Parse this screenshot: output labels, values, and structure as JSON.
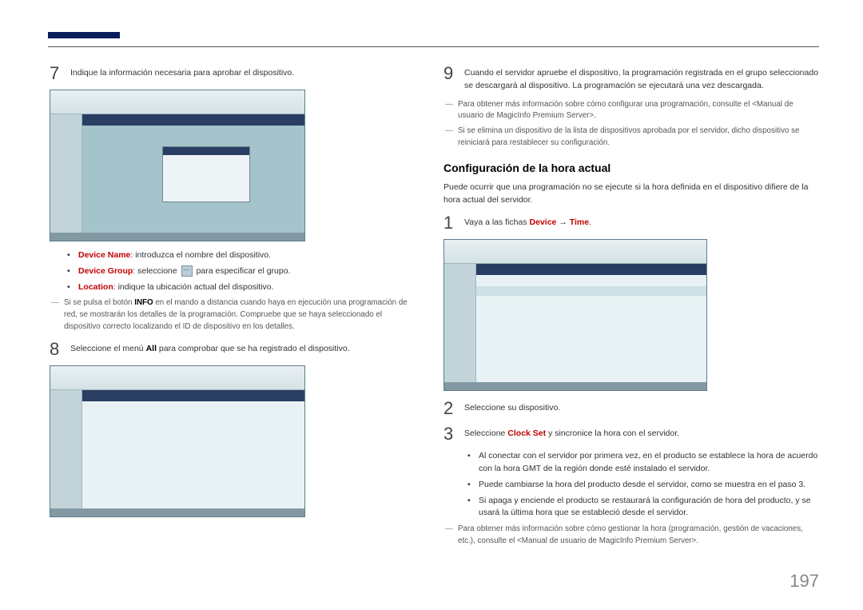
{
  "page_number": "197",
  "left": {
    "step7": {
      "num": "7",
      "text": "Indique la información necesaria para aprobar el dispositivo."
    },
    "bullets7": {
      "b1_label": "Device Name",
      "b1_rest": ": introduzca el nombre del dispositivo.",
      "b2_label": "Device Group",
      "b2_rest_a": ": seleccione ",
      "b2_rest_b": " para especificar el grupo.",
      "b3_label": "Location",
      "b3_rest": ": indique la ubicación actual del dispositivo."
    },
    "note7_a": "Si se pulsa el botón ",
    "note7_b": "INFO",
    "note7_c": " en el mando a distancia cuando haya en ejecución una programación de red, se mostrarán los detalles de la programación. Compruebe que se haya seleccionado el dispositivo correcto localizando el ID de dispositivo en los detalles.",
    "step8": {
      "num": "8",
      "text_a": "Seleccione el menú ",
      "text_b": "All",
      "text_c": " para comprobar que se ha registrado el dispositivo."
    }
  },
  "right": {
    "step9": {
      "num": "9",
      "text": "Cuando el servidor apruebe el dispositivo, la programación registrada en el grupo seleccionado se descargará al dispositivo. La programación se ejecutará una vez descargada."
    },
    "note9a": "Para obtener más información sobre cómo configurar una programación, consulte el <Manual de usuario de MagicInfo Premium Server>.",
    "note9b": "Si se elimina un dispositivo de la lista de dispositivos aprobada por el servidor, dicho dispositivo se reiniciará para restablecer su configuración.",
    "h_time": "Configuración de la hora actual",
    "time_intro": "Puede ocurrir que una programación no se ejecute si la hora definida en el dispositivo difiere de la hora actual del servidor.",
    "t1": {
      "num": "1",
      "a": "Vaya a las fichas ",
      "b": "Device",
      "c": " → ",
      "d": "Time",
      "e": "."
    },
    "t2": {
      "num": "2",
      "text": "Seleccione su dispositivo."
    },
    "t3": {
      "num": "3",
      "a": "Seleccione ",
      "b": "Clock Set",
      "c": " y sincronice la hora con el servidor."
    },
    "t_bullets": {
      "b1": "Al conectar con el servidor por primera vez, en el producto se establece la hora de acuerdo con la hora GMT de la región donde esté instalado el servidor.",
      "b2": "Puede cambiarse la hora del producto desde el servidor, como se muestra en el paso 3.",
      "b3": "Si apaga y enciende el producto se restaurará la configuración de hora del producto, y se usará la última hora que se estableció desde el servidor."
    },
    "t_note": "Para obtener más información sobre cómo gestionar la hora (programación, gestión de vacaciones, etc.), consulte el <Manual de usuario de MagicInfo Premium Server>."
  }
}
